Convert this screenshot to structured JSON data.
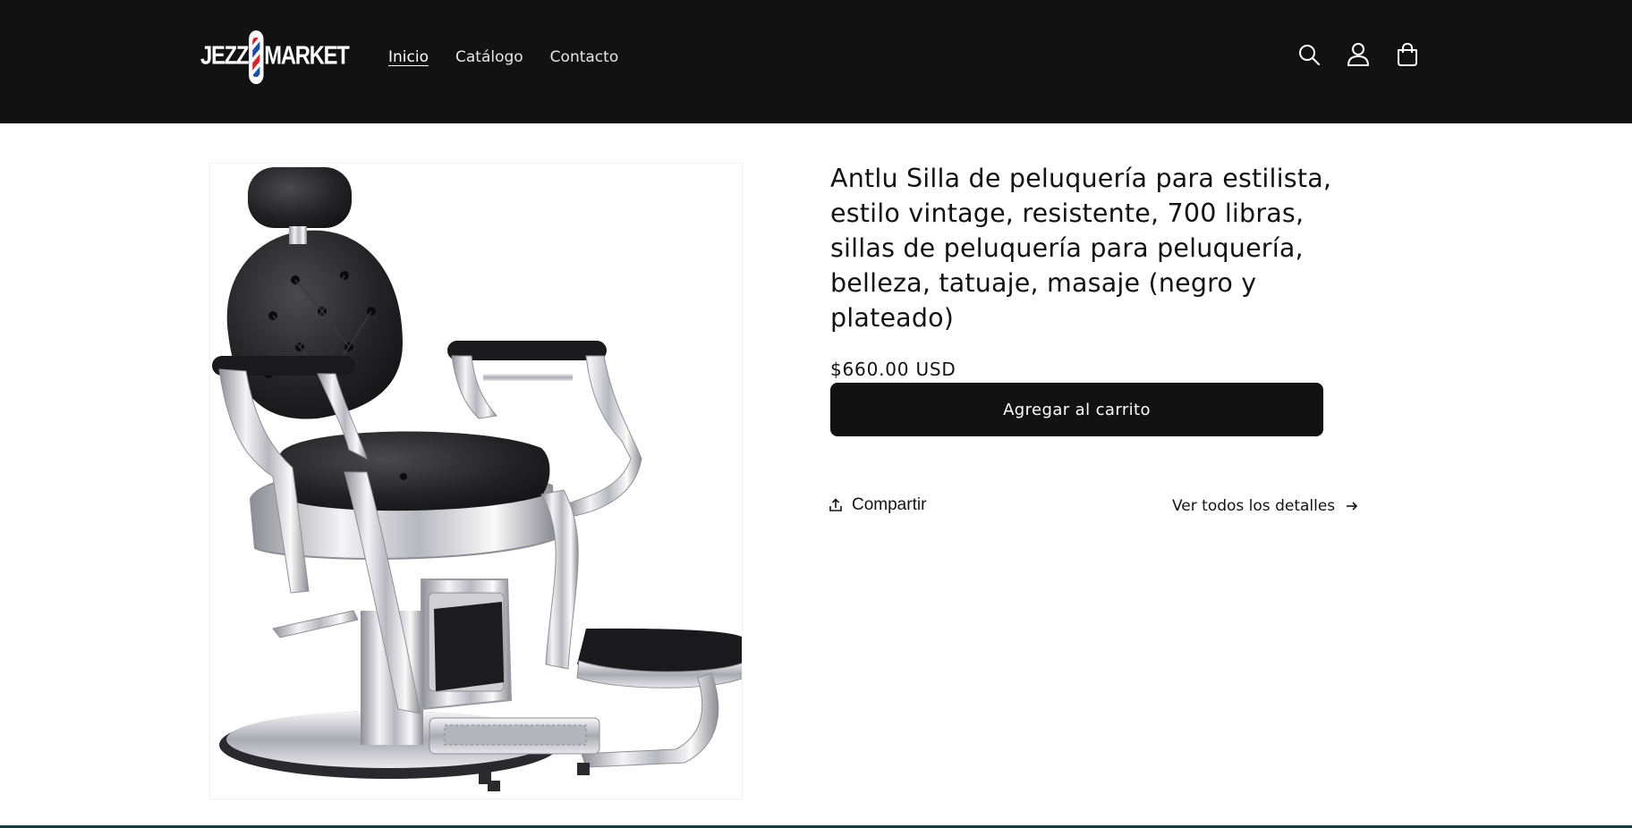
{
  "header": {
    "logo": {
      "left": "JEZZ",
      "right": "MARKET"
    },
    "nav": [
      {
        "label": "Inicio",
        "active": true
      },
      {
        "label": "Catálogo",
        "active": false
      },
      {
        "label": "Contacto",
        "active": false
      }
    ],
    "icons": [
      "search-icon",
      "account-icon",
      "cart-icon"
    ]
  },
  "product": {
    "title": "Antlu Silla de peluquería para estilista, estilo vintage, resistente, 700 libras, sillas de peluquería para peluquería, belleza, tatuaje, masaje (negro y plateado)",
    "price": "$660.00 USD",
    "add_to_cart_label": "Agregar al carrito",
    "share_label": "Compartir",
    "details_label": "Ver todos los detalles"
  },
  "colors": {
    "header_bg": "#121212",
    "button_bg": "#121212",
    "pole_red": "#d0282e",
    "pole_blue": "#1f4fa8"
  }
}
